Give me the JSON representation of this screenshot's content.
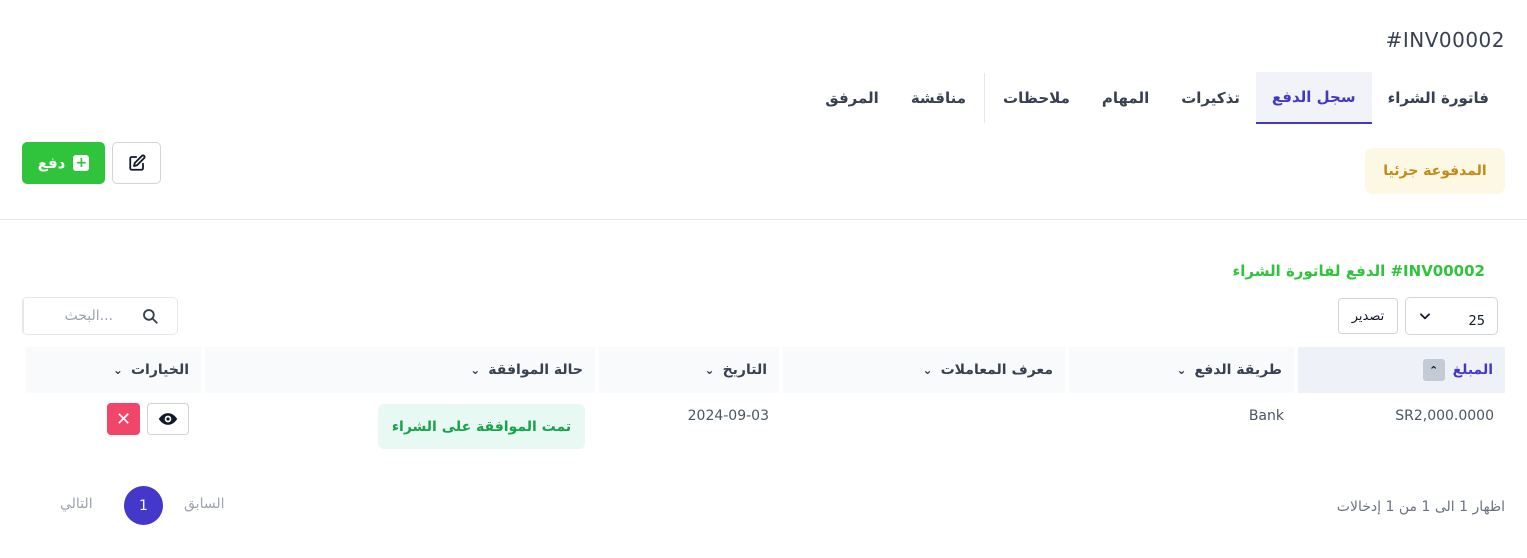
{
  "invoice": {
    "title": "#INV00002"
  },
  "tabs": [
    {
      "label": "فاتورة الشراء",
      "active": false
    },
    {
      "label": "سجل الدفع",
      "active": true
    },
    {
      "label": "تذكيرات",
      "active": false
    },
    {
      "label": "المهام",
      "active": false
    },
    {
      "label": "ملاحظات",
      "active": false
    },
    {
      "label": "مناقشة",
      "active": false
    },
    {
      "label": "المرفق",
      "active": false
    }
  ],
  "actions": {
    "pay_label": "دفع",
    "edit_icon": "edit-icon",
    "plus_icon": "plus-square-icon"
  },
  "status": {
    "label": "المدفوعة جزئيا",
    "color": "#c48a16",
    "bg": "#fdf8e4"
  },
  "section": {
    "title": "الدفع لفاتورة الشراء #INV00002"
  },
  "table_controls": {
    "page_length": "25",
    "export_label": "تصدير",
    "search_placeholder": "البحث..."
  },
  "table": {
    "columns": [
      "المبلغ",
      "طريقة الدفع",
      "معرف المعاملات",
      "التاريخ",
      "حالة الموافقة",
      "الخيارات"
    ],
    "rows": [
      {
        "amount": "SR2,000.0000",
        "method": "Bank",
        "transaction_id": "",
        "date": "2024-09-03",
        "approval": "تمت الموافقة على الشراء"
      }
    ]
  },
  "pagination": {
    "info": "اظهار 1 الى 1 من 1 إدخالات",
    "prev": "السابق",
    "current": "1",
    "next": "التالي"
  },
  "colors": {
    "accent": "#4338ca",
    "success": "#2fc43b",
    "danger": "#f2456a"
  }
}
